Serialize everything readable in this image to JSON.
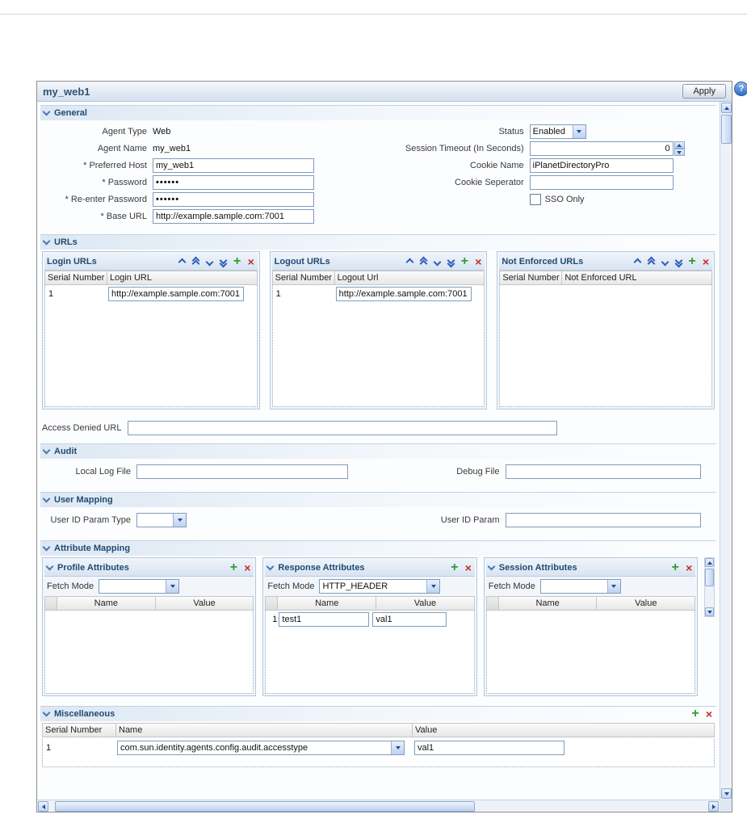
{
  "page": {
    "title": "my_web1",
    "apply_label": "Apply"
  },
  "icons": {
    "add": "+",
    "delete": "×",
    "help": "?"
  },
  "theme": {
    "accent": "#2d5fb8",
    "section_text": "#1e4a73",
    "add_color": "#2f9c30",
    "delete_color": "#c92b24",
    "input_border": "#7f9db9"
  },
  "general": {
    "section_label": "General",
    "agent_type": {
      "label": "Agent Type",
      "value": "Web"
    },
    "agent_name": {
      "label": "Agent Name",
      "value": "my_web1"
    },
    "preferred_host": {
      "label": "* Preferred Host",
      "value": "my_web1"
    },
    "password": {
      "label": "* Password",
      "value": "••••••"
    },
    "reenter_password": {
      "label": "* Re-enter Password",
      "value": "••••••"
    },
    "base_url": {
      "label": "* Base URL",
      "value": "http://example.sample.com:7001"
    },
    "status": {
      "label": "Status",
      "value": "Enabled"
    },
    "session_timeout": {
      "label": "Session Timeout (In Seconds)",
      "value": "0"
    },
    "cookie_name": {
      "label": "Cookie Name",
      "value": "iPlanetDirectoryPro"
    },
    "cookie_seperator": {
      "label": "Cookie Seperator",
      "value": ""
    },
    "sso_only_label": "SSO Only"
  },
  "urls": {
    "section_label": "URLs",
    "login": {
      "title": "Login URLs",
      "headers": [
        "Serial Number",
        "Login URL"
      ],
      "rows": [
        {
          "serial": "1",
          "url": "http://example.sample.com:7001"
        }
      ]
    },
    "logout": {
      "title": "Logout URLs",
      "headers": [
        "Serial Number",
        "Logout Url"
      ],
      "rows": [
        {
          "serial": "1",
          "url": "http://example.sample.com:7001"
        }
      ]
    },
    "not_enforced": {
      "title": "Not Enforced URLs",
      "headers": [
        "Serial Number",
        "Not Enforced URL"
      ],
      "rows": []
    },
    "access_denied": {
      "label": "Access Denied URL",
      "value": ""
    }
  },
  "audit": {
    "section_label": "Audit",
    "local_log_file": {
      "label": "Local Log File",
      "value": ""
    },
    "debug_file": {
      "label": "Debug File",
      "value": ""
    }
  },
  "user_mapping": {
    "section_label": "User Mapping",
    "user_id_param_type": {
      "label": "User ID Param Type",
      "value": ""
    },
    "user_id_param": {
      "label": "User ID Param",
      "value": ""
    }
  },
  "attribute_mapping": {
    "section_label": "Attribute Mapping",
    "profile": {
      "title": "Profile Attributes",
      "fetch_mode_label": "Fetch Mode",
      "fetch_mode_value": "",
      "headers": [
        "Name",
        "Value"
      ],
      "rows": []
    },
    "response": {
      "title": "Response Attributes",
      "fetch_mode_label": "Fetch Mode",
      "fetch_mode_value": "HTTP_HEADER",
      "headers": [
        "Name",
        "Value"
      ],
      "rows": [
        {
          "num": "1",
          "name": "test1",
          "value": "val1"
        }
      ]
    },
    "session": {
      "title": "Session Attributes",
      "fetch_mode_label": "Fetch Mode",
      "fetch_mode_value": "",
      "headers": [
        "Name",
        "Value"
      ],
      "rows": []
    }
  },
  "miscellaneous": {
    "section_label": "Miscellaneous",
    "headers": [
      "Serial Number",
      "Name",
      "Value"
    ],
    "rows": [
      {
        "serial": "1",
        "name": "com.sun.identity.agents.config.audit.accesstype",
        "value": "val1"
      }
    ]
  }
}
